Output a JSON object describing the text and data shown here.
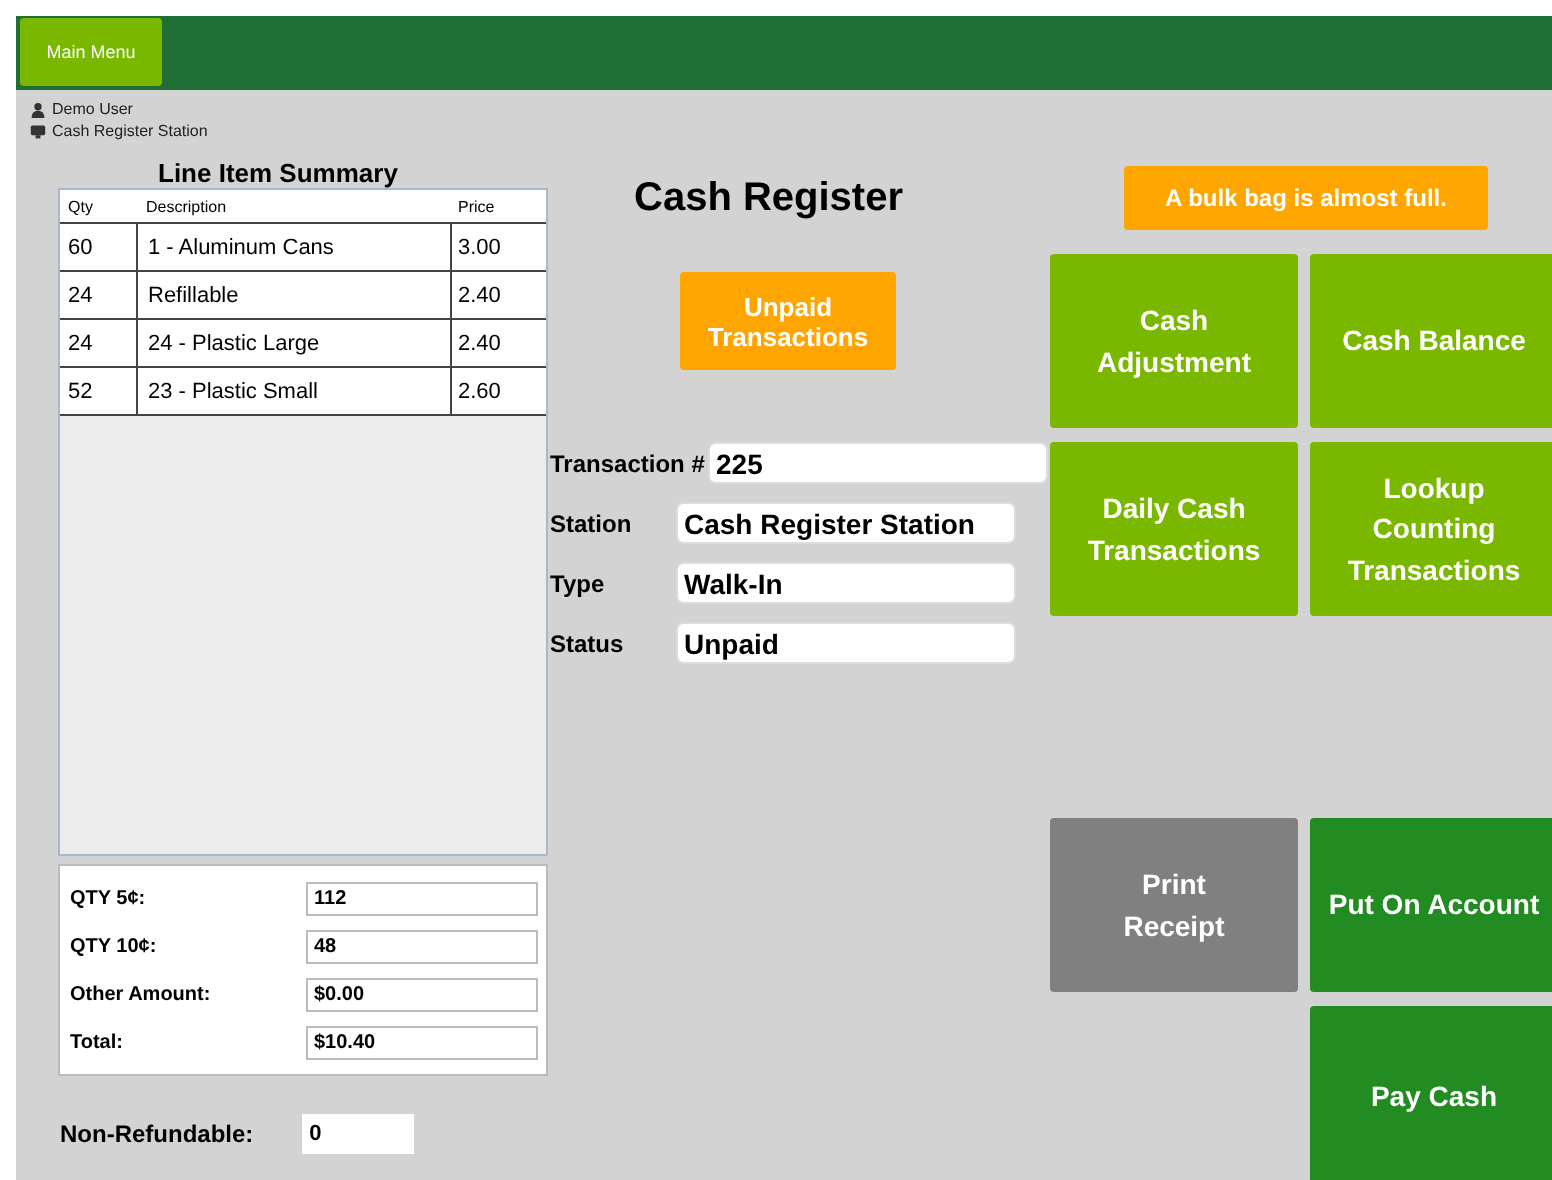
{
  "top_bar": {
    "main_menu": "Main Menu"
  },
  "user": {
    "name": "Demo User",
    "station": "Cash Register Station"
  },
  "line_items": {
    "title": "Line Item Summary",
    "columns": [
      "Qty",
      "Description",
      "Price"
    ],
    "rows": [
      [
        "60",
        "1 - Aluminum Cans",
        "3.00"
      ],
      [
        "24",
        "Refillable",
        "2.40"
      ],
      [
        "24",
        "24 - Plastic Large",
        "2.40"
      ],
      [
        "52",
        "23 - Plastic Small",
        "2.60"
      ]
    ]
  },
  "totals": [
    {
      "label": "QTY 5¢:",
      "value": "112"
    },
    {
      "label": "QTY 10¢:",
      "value": "48"
    },
    {
      "label": "Other Amount:",
      "value": "$0.00"
    },
    {
      "label": "Total:",
      "value": "$10.40"
    }
  ],
  "non_refundable": {
    "label": "Non-Refundable:",
    "value": "0"
  },
  "title": "Cash Register",
  "unpaid_button": "Unpaid Transactions",
  "fields": [
    {
      "label": "Transaction #",
      "value": "225",
      "kind": "short"
    },
    {
      "label": "Station",
      "value": "Cash Register Station",
      "kind": "wide"
    },
    {
      "label": "Type",
      "value": "Walk-In",
      "kind": "wide"
    },
    {
      "label": "Status",
      "value": "Unpaid",
      "kind": "wide"
    }
  ],
  "alert": "A bulk bag is almost full.",
  "buttons": [
    {
      "label": "Cash Adjustment",
      "kind": "lime"
    },
    {
      "label": "Cash Balance",
      "kind": "lime"
    },
    {
      "label": "Daily Cash Transactions",
      "kind": "lime"
    },
    {
      "label": "Lookup Counting Transactions",
      "kind": "lime"
    },
    {
      "label": "Print Receipt",
      "kind": "grey"
    },
    {
      "label": "Put On Account",
      "kind": "green"
    },
    {
      "label": "Pay Cash",
      "kind": "green"
    }
  ]
}
